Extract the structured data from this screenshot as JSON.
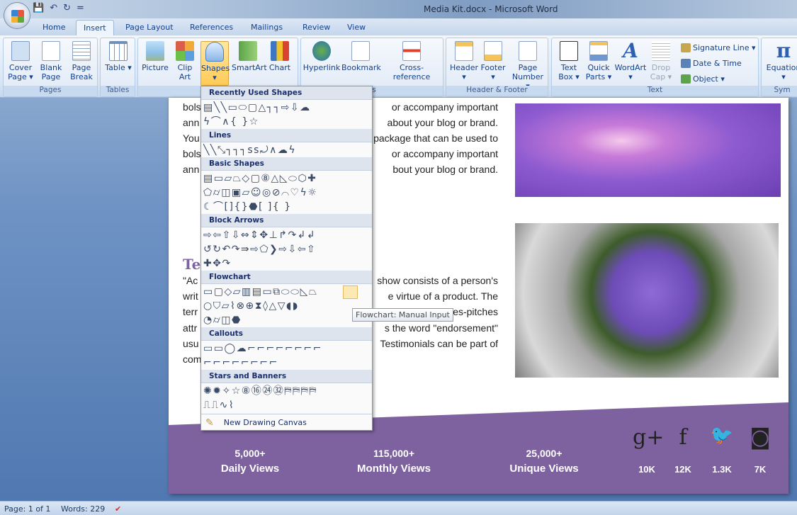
{
  "window": {
    "title": "Media Kit.docx - Microsoft Word"
  },
  "qat": {
    "save": "💾",
    "undo": "↶",
    "redo": "↻",
    "more": "="
  },
  "tabs": [
    "Home",
    "Insert",
    "Page Layout",
    "References",
    "Mailings",
    "Review",
    "View"
  ],
  "ribbon": {
    "pages": {
      "label": "Pages",
      "buttons": [
        "Cover Page ▾",
        "Blank Page",
        "Page Break"
      ]
    },
    "tables": {
      "label": "Tables",
      "buttons": [
        "Table ▾"
      ]
    },
    "illustrations": {
      "label": "Il",
      "buttons": [
        "Picture",
        "Clip Art",
        "Shapes ▾",
        "SmartArt",
        "Chart"
      ]
    },
    "links": {
      "label": "ks",
      "buttons": [
        "Hyperlink",
        "Bookmark",
        "Cross-reference"
      ]
    },
    "header_footer": {
      "label": "Header & Footer",
      "buttons": [
        "Header ▾",
        "Footer ▾",
        "Page Number ▾"
      ]
    },
    "text": {
      "label": "Text",
      "buttons": [
        "Text Box ▾",
        "Quick Parts ▾",
        "WordArt ▾",
        "Drop Cap ▾"
      ],
      "small": [
        "Signature Line ▾",
        "Date & Time",
        "Object ▾"
      ]
    },
    "symbols": {
      "label": "Sym",
      "buttons": [
        "Equation ▾"
      ]
    }
  },
  "shapes_menu": {
    "sections": [
      {
        "title": "Recently Used Shapes",
        "rows": [
          "▤╲╲▭⬭▢△┐┐⇨⇩☁",
          "ϟ⌒∧{ }☆"
        ]
      },
      {
        "title": "Lines",
        "rows": [
          "╲╲⤡┐┐┐ꜱꜱ⤾∧☁ϟ"
        ]
      },
      {
        "title": "Basic Shapes",
        "rows": [
          "▤▭▱⏢◇▢⑧△◺⬭⬡✚",
          "⬠⌭◫▣▱☺◎⊘⌒♡ϟ☼",
          "☾⌒[]{}⬣[ ]{ }"
        ]
      },
      {
        "title": "Block Arrows",
        "rows": [
          "⇨⇦⇧⇩⇔⇕✥⊥↱↷↲↲",
          "↺↻↶↷⇛⇨⬠❯⇨⇩⇦⇧",
          "✚✥↷"
        ]
      },
      {
        "title": "Flowchart",
        "rows": [
          "▭▢◇▱▥▤▭⧉⬭⬭◺⏢",
          "○⛉▱⌇⊗⊕⧗◊△▽◖◗",
          "◔⌭◫⬣"
        ]
      },
      {
        "title": "Callouts",
        "rows": [
          "▭▭◯☁⌐⌐⌐⌐⌐⌐⌐⌐",
          "⌐⌐⌐⌐⌐⌐⌐⌐"
        ]
      },
      {
        "title": "Stars and Banners",
        "rows": [
          "✺✹✧☆⑧⑯㉔㉜⛿⛿⛿⛿",
          "⎍⎍∿⌇"
        ]
      }
    ],
    "new_canvas": "New Drawing Canvas",
    "tooltip": "Flowchart: Manual Input"
  },
  "document": {
    "lines": [
      [
        "bols",
        "or accompany important"
      ],
      [
        "ann",
        "about your blog or brand."
      ],
      [
        "You",
        "package that can be used to"
      ],
      [
        "bols",
        "or accompany important"
      ],
      [
        "ann",
        "bout your blog or brand."
      ],
      [
        "\"Ac",
        "show consists of a person's"
      ],
      [
        "writ",
        "e virtue of a product. The"
      ],
      [
        "terr",
        "les-pitches"
      ],
      [
        "attr",
        "s the word \"endorsement\""
      ],
      [
        "usu",
        "Testimonials can be part of"
      ],
      [
        "com",
        ""
      ]
    ],
    "heading": "Te",
    "stats": [
      {
        "value": "5,000+",
        "label": "Daily Views"
      },
      {
        "value": "115,000+",
        "label": "Monthly Views"
      },
      {
        "value": "25,000+",
        "label": "Unique Views"
      }
    ],
    "social": [
      {
        "icon": "google-plus-icon",
        "glyph": "g+",
        "count": "10K"
      },
      {
        "icon": "facebook-icon",
        "glyph": "f",
        "count": "12K"
      },
      {
        "icon": "twitter-icon",
        "glyph": "🐦",
        "count": "1.3K"
      },
      {
        "icon": "instagram-icon",
        "glyph": "◙",
        "count": "7K"
      }
    ],
    "colors": {
      "footer": "#7e62a0",
      "heading": "#7d63a0"
    }
  },
  "status": {
    "page": "Page: 1 of 1",
    "words": "Words: 229"
  }
}
